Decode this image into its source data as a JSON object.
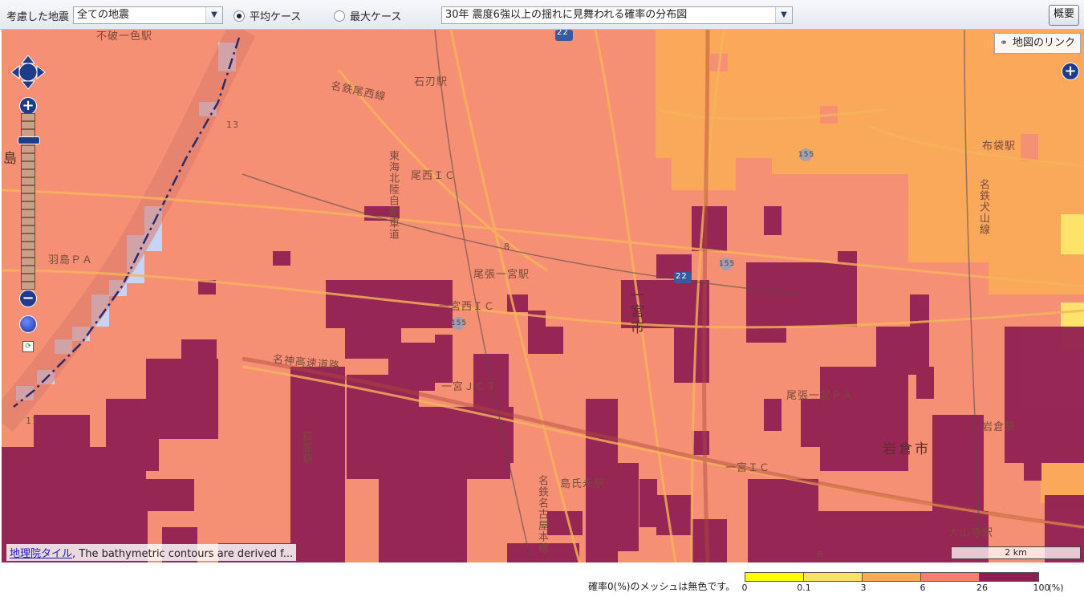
{
  "toolbar": {
    "earthquake_label": "考慮した地震",
    "earthquake_value": "全ての地震",
    "case_average": "平均ケース",
    "case_max": "最大ケース",
    "map_type_value": "30年 震度6強以上の揺れに見舞われる確率の分布図",
    "overview_button": "概要",
    "selected_case": "平均ケース"
  },
  "map": {
    "link_button": "地図のリンク",
    "attribution_link": "地理院タイル",
    "attribution_text": ", The bathymetric contours are derived f...",
    "scale_label": "2 km",
    "place_labels": [
      "不破一色駅",
      "石刃駅",
      "名鉄尾西線",
      "尾西ＩＣ",
      "東海北陸自動車道",
      "羽島ＰＡ",
      "尾張一宮駅",
      "一宮西ＩＣ",
      "一宮市",
      "名神高速道路",
      "一宮ＪＣＴ",
      "尾張一宮ＰＡ",
      "岩倉駅",
      "岩倉市",
      "一宮ＩＣ",
      "島氏永駅",
      "名鉄名古屋本線",
      "布袋駅",
      "名鉄犬山線",
      "大山寺駅",
      "荻原駅",
      "島",
      "22",
      "155",
      "13",
      "11",
      "8"
    ],
    "colors": {
      "base_probability": "#f59075",
      "high_probability": "#8e1f52",
      "mid_probability": "#fbaa58",
      "low_mesh": "#c7d5f5",
      "road": "#f7b55a"
    }
  },
  "legend": {
    "caption": "確率0(%)のメッシュは無色です。",
    "unit": "(%)",
    "ticks": [
      "0",
      "0.1",
      "3",
      "6",
      "26",
      "100"
    ],
    "colors": [
      "#ffff00",
      "#fce164",
      "#fbaa58",
      "#f7806c",
      "#f06068",
      "#8e1f52"
    ]
  },
  "icons": [
    "pan-control-icon",
    "zoom-in-icon",
    "zoom-out-icon",
    "globe-icon",
    "layer-switch-icon",
    "link-icon",
    "chevron-down-icon"
  ]
}
